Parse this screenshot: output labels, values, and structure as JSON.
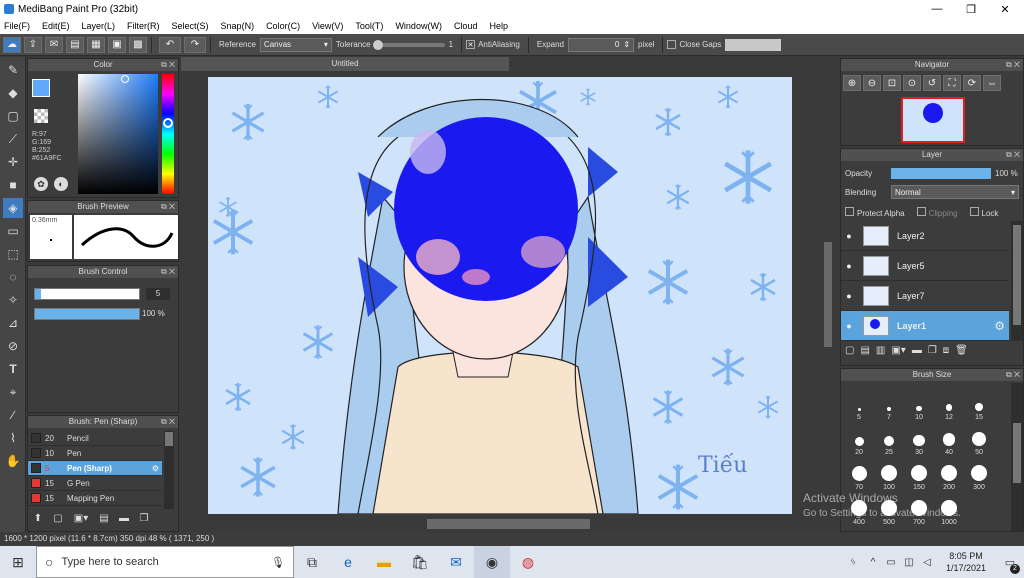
{
  "window": {
    "title": "MediBang Paint Pro (32bit)",
    "minimize": "—",
    "maximize": "❐",
    "close": "✕"
  },
  "menu": [
    "File(F)",
    "Edit(E)",
    "Layer(L)",
    "Filter(R)",
    "Select(S)",
    "Snap(N)",
    "Color(C)",
    "View(V)",
    "Tool(T)",
    "Window(W)",
    "Cloud",
    "Help"
  ],
  "toolbar": {
    "reference_label": "Reference",
    "reference_value": "Canvas",
    "tolerance_label": "Tolerance",
    "tolerance_value": "1",
    "antialias_label": "AntiAliasing",
    "antialias_check": "✕",
    "expand_label": "Expand",
    "expand_value": "0",
    "expand_unit": "pixel",
    "closegaps_label": "Close Gaps"
  },
  "color_panel": {
    "title": "Color",
    "r": "R:97",
    "g": "G:169",
    "b": "B:252",
    "hex": "#61A9FC",
    "current_color": "#61a9fc"
  },
  "brush_preview": {
    "title": "Brush Preview",
    "size": "0.36mm"
  },
  "brush_control": {
    "title": "Brush Control",
    "size_value": "5",
    "opacity_value": "100 %",
    "opacity_fraction": 1.0
  },
  "brush_list": {
    "title": "Brush: Pen (Sharp)",
    "items": [
      {
        "size": "20",
        "name": "Pencil",
        "color": "#333333"
      },
      {
        "size": "10",
        "name": "Pen",
        "color": "#333333"
      },
      {
        "size": "5",
        "name": "Pen (Sharp)",
        "color": "#333333"
      },
      {
        "size": "15",
        "name": "G Pen",
        "color": "#e53935"
      },
      {
        "size": "15",
        "name": "Mapping Pen",
        "color": "#e53935"
      }
    ]
  },
  "document": {
    "tab": "Untitled",
    "signature": "Tiếu"
  },
  "navigator": {
    "title": "Navigator"
  },
  "layer_panel": {
    "title": "Layer",
    "opacity_label": "Opacity",
    "opacity_value": "100 %",
    "opacity_fraction": 1.0,
    "blending_label": "Blending",
    "blending_value": "Normal",
    "protect_alpha": "Protect Alpha",
    "clipping": "Clipping",
    "lock": "Lock",
    "layers": [
      "Layer2",
      "Layer5",
      "Layer7",
      "Layer1"
    ]
  },
  "brush_size": {
    "title": "Brush Size",
    "sizes": [
      "5",
      "7",
      "10",
      "12",
      "15",
      "20",
      "25",
      "30",
      "40",
      "50",
      "70",
      "100",
      "150",
      "200",
      "300",
      "400",
      "500",
      "700",
      "1000"
    ]
  },
  "status": {
    "text": "1600 * 1200 pixel   (11.6 * 8.7cm)   350 dpi   48 %   ( 1371, 250 )"
  },
  "watermark": {
    "line1": "Activate Windows",
    "line2": "Go to Settings to activate Windows."
  },
  "taskbar": {
    "search_placeholder": "Type here to search",
    "time": "8:05 PM",
    "date": "1/17/2021",
    "notifications": "2"
  }
}
